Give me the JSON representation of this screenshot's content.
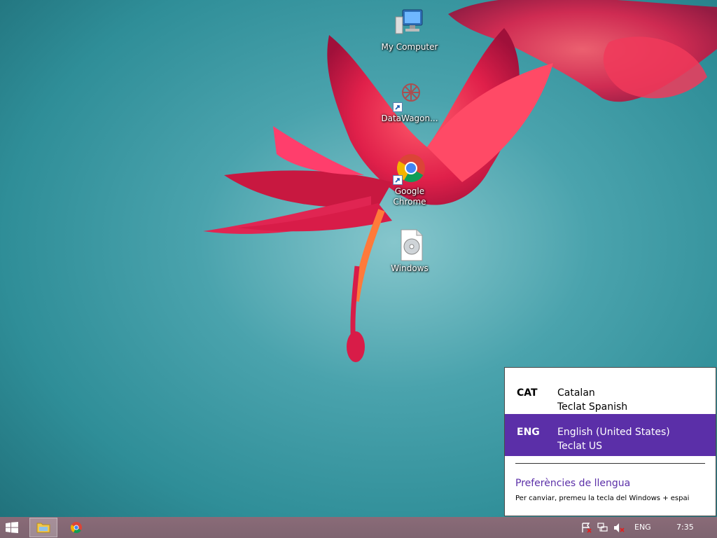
{
  "desktop": {
    "icons": [
      {
        "label": "My Computer",
        "icon": "computer-icon"
      },
      {
        "label": "DataWagon...",
        "icon": "datawagon-icon"
      },
      {
        "label": "Google Chrome",
        "icon": "chrome-icon"
      },
      {
        "label": "Windows",
        "icon": "disc-file-icon"
      }
    ]
  },
  "language_popup": {
    "items": [
      {
        "code": "CAT",
        "name": "Catalan",
        "keyboard": "Teclat Spanish",
        "selected": false
      },
      {
        "code": "ENG",
        "name": "English (United States)",
        "keyboard": "Teclat US",
        "selected": true
      }
    ],
    "preferences_link": "Preferències de llengua",
    "hint": "Per canviar, premeu la tecla del Windows + espai",
    "accent_color": "#5b2fa8"
  },
  "taskbar": {
    "pinned": [
      {
        "icon": "file-explorer-icon",
        "active": true
      },
      {
        "icon": "chrome-icon",
        "active": false
      }
    ],
    "tray": {
      "icons": [
        "action-center-flag-icon",
        "network-icon",
        "volume-muted-icon"
      ],
      "language": "ENG",
      "clock": "7:35"
    }
  }
}
